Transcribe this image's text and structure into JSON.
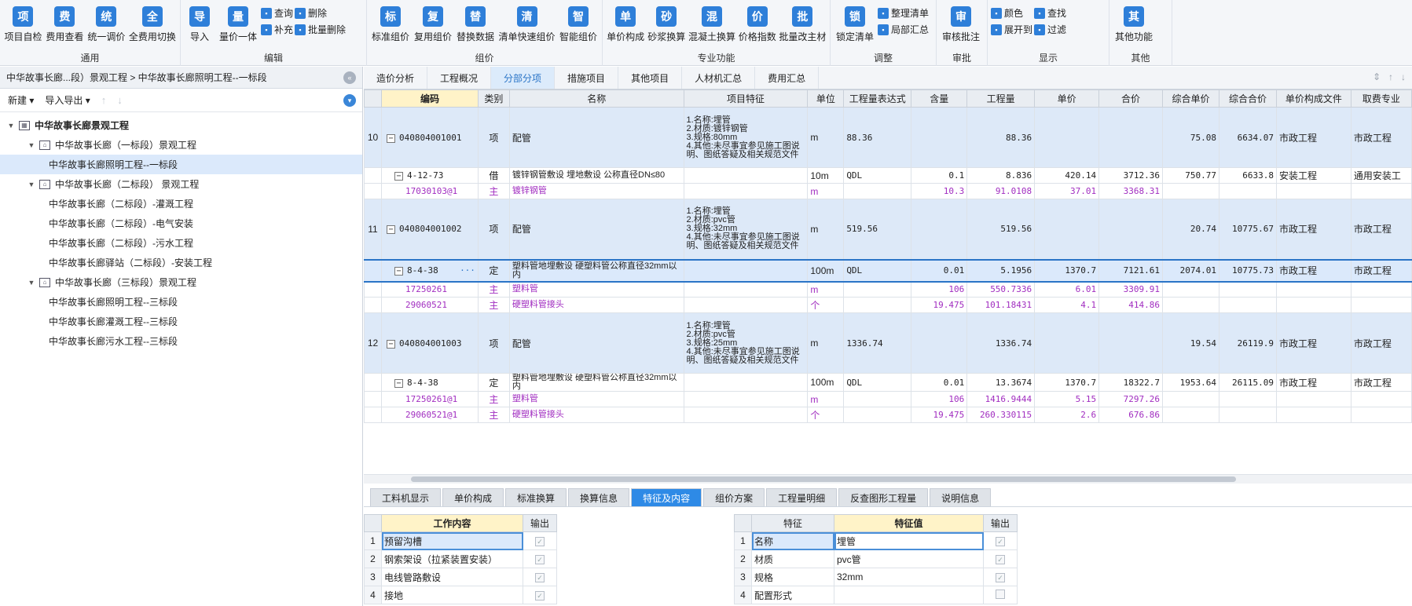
{
  "ribbon": {
    "groups": [
      {
        "id": "general",
        "label": "通用",
        "buttons": [
          {
            "label": "项目自检",
            "icon": "check-icon"
          },
          {
            "label": "费用查看",
            "icon": "view-cost-icon"
          },
          {
            "label": "统一调价",
            "icon": "adjust-price-icon"
          },
          {
            "label": "全费用切换",
            "icon": "switch-icon"
          }
        ]
      },
      {
        "id": "edit",
        "label": "编辑",
        "buttons": [
          {
            "label": "导入",
            "icon": "import-icon"
          },
          {
            "label": "量价一体",
            "icon": "qty-price-icon"
          }
        ],
        "small": [
          [
            "查询",
            "补充"
          ],
          [
            "删除",
            "批量删除"
          ]
        ]
      },
      {
        "id": "pricing",
        "label": "组价",
        "buttons": [
          {
            "label": "标准组价",
            "icon": "standard-price-icon"
          },
          {
            "label": "复用组价",
            "icon": "reuse-price-icon"
          },
          {
            "label": "替换数据",
            "icon": "replace-icon"
          },
          {
            "label": "清单快速组价",
            "icon": "quick-price-icon"
          },
          {
            "label": "智能组价",
            "icon": "smart-price-icon"
          }
        ]
      },
      {
        "id": "professional",
        "label": "专业功能",
        "buttons": [
          {
            "label": "单价构成",
            "icon": "unit-price-icon"
          },
          {
            "label": "砂浆换算",
            "icon": "mortar-icon"
          },
          {
            "label": "混凝土换算",
            "icon": "concrete-icon"
          },
          {
            "label": "价格指数",
            "icon": "price-index-icon"
          },
          {
            "label": "批量改主材",
            "icon": "batch-material-icon"
          }
        ]
      },
      {
        "id": "adjust",
        "label": "调整",
        "buttons": [
          {
            "label": "锁定清单",
            "icon": "lock-icon"
          }
        ],
        "small": [
          [
            "整理清单",
            "局部汇总"
          ]
        ]
      },
      {
        "id": "review",
        "label": "审批",
        "buttons": [
          {
            "label": "审核批注",
            "icon": "review-icon"
          }
        ]
      },
      {
        "id": "display",
        "label": "显示",
        "small": [
          [
            "颜色",
            "展开到"
          ],
          [
            "查找",
            "过滤"
          ]
        ]
      },
      {
        "id": "other",
        "label": "其他",
        "buttons": [
          {
            "label": "其他功能",
            "icon": "grid-icon"
          }
        ]
      }
    ]
  },
  "left": {
    "breadcrumb": "中华故事长廊...段）景观工程 > 中华故事长廊照明工程--一标段",
    "toolbar": {
      "new": "新建",
      "import_export": "导入导出"
    },
    "tree": [
      {
        "label": "中华故事长廊景观工程",
        "level": 0,
        "root": true
      },
      {
        "label": "中华故事长廊（一标段）景观工程",
        "level": 1,
        "group": true
      },
      {
        "label": "中华故事长廊照明工程--一标段",
        "level": 2,
        "selected": true
      },
      {
        "label": "中华故事长廊（二标段） 景观工程",
        "level": 1,
        "group": true
      },
      {
        "label": "中华故事长廊（二标段）-灌溉工程",
        "level": 2
      },
      {
        "label": "中华故事长廊（二标段）-电气安装",
        "level": 2
      },
      {
        "label": "中华故事长廊（二标段）-污水工程",
        "level": 2
      },
      {
        "label": "中华故事长廊驿站（二标段）-安装工程",
        "level": 2
      },
      {
        "label": "中华故事长廊（三标段）景观工程",
        "level": 1,
        "group": true
      },
      {
        "label": "中华故事长廊照明工程--三标段",
        "level": 2
      },
      {
        "label": "中华故事长廊灌溉工程--三标段",
        "level": 2
      },
      {
        "label": "中华故事长廊污水工程--三标段",
        "level": 2
      }
    ]
  },
  "tabs": [
    "造价分析",
    "工程概况",
    "分部分项",
    "措施项目",
    "其他项目",
    "人材机汇总",
    "费用汇总"
  ],
  "active_tab": "分部分项",
  "grid": {
    "columns": [
      "",
      "编码",
      "类别",
      "名称",
      "项目特征",
      "单位",
      "工程量表达式",
      "含量",
      "工程量",
      "单价",
      "合价",
      "综合单价",
      "综合合价",
      "单价构成文件",
      "取费专业"
    ],
    "rows": [
      {
        "type": "item",
        "no": "10",
        "code": "040804001001",
        "cat": "项",
        "name": "配管",
        "feat": "1.名称:埋管\n2.材质:镀锌钢管\n3.规格:80mm\n4.其他:未尽事宜参见施工图说明、图纸答疑及相关规范文件",
        "unit": "m",
        "expr": "88.36",
        "content": "",
        "qty": "88.36",
        "price": "",
        "total": "",
        "cprice": "75.08",
        "ctotal": "6634.07",
        "file": "市政工程",
        "spec": "市政工程"
      },
      {
        "type": "quota",
        "no": "",
        "code": "4-12-73",
        "cat": "借",
        "name": "镀锌钢管敷设 埋地敷设 公称直径DN≤80",
        "feat": "",
        "unit": "10m",
        "expr": "QDL",
        "content": "0.1",
        "qty": "8.836",
        "price": "420.14",
        "total": "3712.36",
        "cprice": "750.77",
        "ctotal": "6633.8",
        "file": "安装工程",
        "spec": "通用安装工"
      },
      {
        "type": "main",
        "no": "",
        "code": "17030103@1",
        "cat": "主",
        "name": "镀锌钢管",
        "feat": "",
        "unit": "m",
        "expr": "",
        "content": "10.3",
        "qty": "91.0108",
        "price": "37.01",
        "total": "3368.31",
        "cprice": "",
        "ctotal": "",
        "file": "",
        "spec": ""
      },
      {
        "type": "item",
        "no": "11",
        "code": "040804001002",
        "cat": "项",
        "name": "配管",
        "feat": "1.名称:埋管\n2.材质:pvc管\n3.规格:32mm\n4.其他:未尽事宜参见施工图说明、图纸答疑及相关规范文件",
        "unit": "m",
        "expr": "519.56",
        "content": "",
        "qty": "519.56",
        "price": "",
        "total": "",
        "cprice": "20.74",
        "ctotal": "10775.67",
        "file": "市政工程",
        "spec": "市政工程"
      },
      {
        "type": "sel",
        "no": "",
        "code": "8-4-38",
        "cat": "定",
        "name": "塑料管地埋敷设 硬塑料管公称直径32mm以内",
        "feat": "",
        "unit": "100m",
        "expr": "QDL",
        "content": "0.01",
        "qty": "5.1956",
        "price": "1370.7",
        "total": "7121.61",
        "cprice": "2074.01",
        "ctotal": "10775.73",
        "file": "市政工程",
        "spec": "市政工程"
      },
      {
        "type": "main",
        "no": "",
        "code": "17250261",
        "cat": "主",
        "name": "塑料管",
        "feat": "",
        "unit": "m",
        "expr": "",
        "content": "106",
        "qty": "550.7336",
        "price": "6.01",
        "total": "3309.91",
        "cprice": "",
        "ctotal": "",
        "file": "",
        "spec": ""
      },
      {
        "type": "main",
        "no": "",
        "code": "29060521",
        "cat": "主",
        "name": "硬塑料管接头",
        "feat": "",
        "unit": "个",
        "expr": "",
        "content": "19.475",
        "qty": "101.18431",
        "price": "4.1",
        "total": "414.86",
        "cprice": "",
        "ctotal": "",
        "file": "",
        "spec": ""
      },
      {
        "type": "item",
        "no": "12",
        "code": "040804001003",
        "cat": "项",
        "name": "配管",
        "feat": "1.名称:埋管\n2.材质:pvc管\n3.规格:25mm\n4.其他:未尽事宜参见施工图说明、图纸答疑及相关规范文件",
        "unit": "m",
        "expr": "1336.74",
        "content": "",
        "qty": "1336.74",
        "price": "",
        "total": "",
        "cprice": "19.54",
        "ctotal": "26119.9",
        "file": "市政工程",
        "spec": "市政工程"
      },
      {
        "type": "quota",
        "no": "",
        "code": "8-4-38",
        "cat": "定",
        "name": "塑料管地埋敷设 硬塑料管公称直径32mm以内",
        "feat": "",
        "unit": "100m",
        "expr": "QDL",
        "content": "0.01",
        "qty": "13.3674",
        "price": "1370.7",
        "total": "18322.7",
        "cprice": "1953.64",
        "ctotal": "26115.09",
        "file": "市政工程",
        "spec": "市政工程"
      },
      {
        "type": "main",
        "no": "",
        "code": "17250261@1",
        "cat": "主",
        "name": "塑料管",
        "feat": "",
        "unit": "m",
        "expr": "",
        "content": "106",
        "qty": "1416.9444",
        "price": "5.15",
        "total": "7297.26",
        "cprice": "",
        "ctotal": "",
        "file": "",
        "spec": ""
      },
      {
        "type": "main",
        "no": "",
        "code": "29060521@1",
        "cat": "主",
        "name": "硬塑料管接头",
        "feat": "",
        "unit": "个",
        "expr": "",
        "content": "19.475",
        "qty": "260.330115",
        "price": "2.6",
        "total": "676.86",
        "cprice": "",
        "ctotal": "",
        "file": "",
        "spec": ""
      }
    ]
  },
  "bottom_tabs": [
    "工料机显示",
    "单价构成",
    "标准换算",
    "换算信息",
    "特征及内容",
    "组价方案",
    "工程量明细",
    "反查图形工程量",
    "说明信息"
  ],
  "active_bottom_tab": "特征及内容",
  "work_content": {
    "headers": [
      "",
      "工作内容",
      "输出"
    ],
    "rows": [
      {
        "no": "1",
        "text": "预留沟槽"
      },
      {
        "no": "2",
        "text": "钢索架设（拉紧装置安装）"
      },
      {
        "no": "3",
        "text": "电线管路敷设"
      },
      {
        "no": "4",
        "text": "接地"
      }
    ]
  },
  "features": {
    "headers": [
      "",
      "特征",
      "特征值",
      "输出"
    ],
    "rows": [
      {
        "no": "1",
        "name": "名称",
        "value": "埋管",
        "checked": true
      },
      {
        "no": "2",
        "name": "材质",
        "value": "pvc管",
        "checked": true
      },
      {
        "no": "3",
        "name": "规格",
        "value": "32mm",
        "checked": true
      },
      {
        "no": "4",
        "name": "配置形式",
        "value": "",
        "checked": false
      }
    ]
  },
  "colors": {
    "accent": "#2e8ae6",
    "item_row": "#dde9f8",
    "main_material": "#a12dc0"
  }
}
